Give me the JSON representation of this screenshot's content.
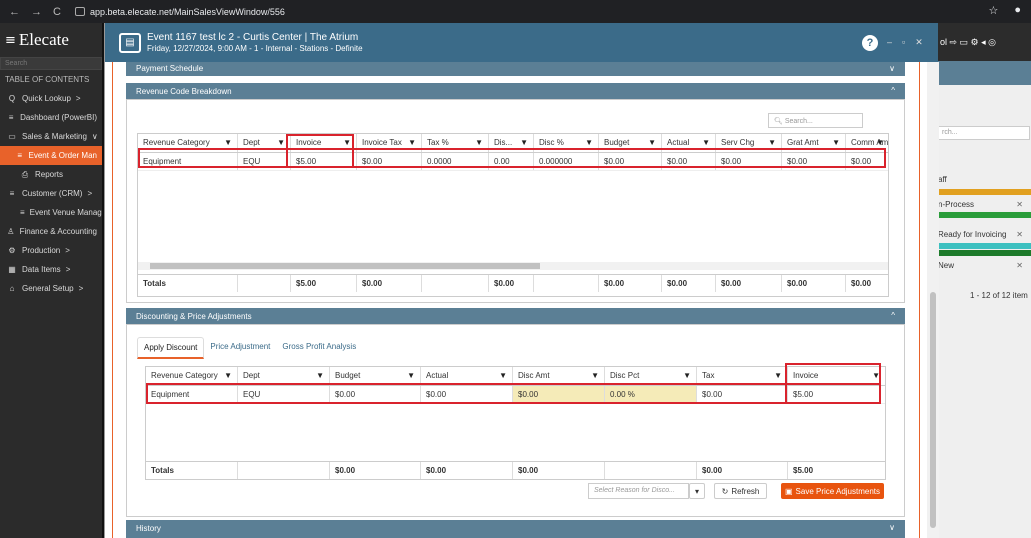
{
  "browser": {
    "url": "app.beta.elecate.net/MainSalesViewWindow/556"
  },
  "sidebar": {
    "brand": "Elecate",
    "search_placeholder": "Search",
    "toc_label": "TABLE OF CONTENTS",
    "items": [
      {
        "label": "Quick Lookup",
        "icon": "Q",
        "chev": ">"
      },
      {
        "label": "Dashboard (PowerBI)",
        "icon": "≡",
        "chev": ""
      },
      {
        "label": "Sales & Marketing",
        "icon": "▭",
        "chev": "∨"
      },
      {
        "label": "Event & Order Man",
        "icon": "≡",
        "chev": ""
      },
      {
        "label": "Reports",
        "icon": "⎙",
        "chev": ""
      },
      {
        "label": "Customer (CRM)",
        "icon": "≡",
        "chev": ">"
      },
      {
        "label": "Event Venue Manage",
        "icon": "≡",
        "chev": ""
      },
      {
        "label": "Finance & Accounting",
        "icon": "♙",
        "chev": ""
      },
      {
        "label": "Production",
        "icon": "⚙",
        "chev": ">"
      },
      {
        "label": "Data Items",
        "icon": "▦",
        "chev": ">"
      },
      {
        "label": "General Setup",
        "icon": "⌂",
        "chev": ">"
      }
    ]
  },
  "right_panel": {
    "search_placeholder": "rch...",
    "rows": [
      {
        "label": "aff",
        "x": ""
      },
      {
        "label": "n-Process",
        "x": "✕"
      },
      {
        "label": "Ready for Invoicing",
        "x": "✕"
      },
      {
        "label": "New",
        "x": "✕"
      }
    ],
    "pager": "1 - 12 of 12 item"
  },
  "modal": {
    "title": "Event 1167 test lc 2 - Curtis Center | The Atrium",
    "subtitle": "Friday, 12/27/2024, 9:00 AM - 1 - Internal - Stations - Definite",
    "help": "?",
    "sections": {
      "payment": "Payment Schedule",
      "revenue": "Revenue Code Breakdown",
      "discounting": "Discounting & Price Adjustments",
      "history": "History"
    },
    "revenue_grid": {
      "search_placeholder": "Search...",
      "headers": [
        "Revenue Category",
        "Dept",
        "Invoice",
        "Invoice Tax",
        "Tax %",
        "Dis...",
        "Disc %",
        "Budget",
        "Actual",
        "Serv Chg",
        "Grat Amt",
        "Comm Am"
      ],
      "row": [
        "Equipment",
        "EQU",
        "$5.00",
        "$0.00",
        "0.0000",
        "0.00",
        "0.000000",
        "$0.00",
        "$0.00",
        "$0.00",
        "$0.00",
        "$0.00"
      ],
      "totals": [
        "Totals",
        "",
        "$5.00",
        "$0.00",
        "",
        "$0.00",
        "",
        "$0.00",
        "$0.00",
        "$0.00",
        "$0.00",
        "$0.00"
      ]
    },
    "tabs": [
      "Apply Discount",
      "Price Adjustment",
      "Gross Profit Analysis"
    ],
    "discount_grid": {
      "headers": [
        "Revenue Category",
        "Dept",
        "Budget",
        "Actual",
        "Disc Amt",
        "Disc Pct",
        "Tax",
        "Invoice"
      ],
      "row": [
        "Equipment",
        "EQU",
        "$0.00",
        "$0.00",
        "$0.00",
        "0.00 %",
        "$0.00",
        "$5.00"
      ],
      "totals": [
        "Totals",
        "",
        "$0.00",
        "$0.00",
        "$0.00",
        "",
        "$0.00",
        "$5.00"
      ]
    },
    "reason_placeholder": "Select Reason for Disco...",
    "refresh_label": "Refresh",
    "save_label": "Save Price Adjustments"
  },
  "colors": {
    "accent": "#e8622a",
    "header_blue": "#5b7f95",
    "title_blue": "#3b6b89",
    "highlight_red": "#d9232d"
  }
}
